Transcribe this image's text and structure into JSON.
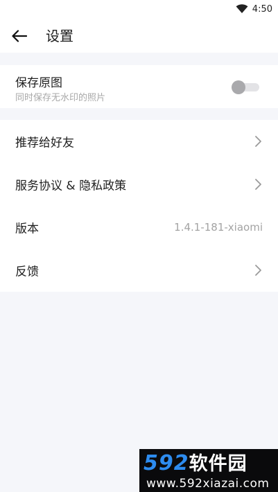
{
  "status_bar": {
    "time": "4:50",
    "wifi_icon": "wifi-icon"
  },
  "app_bar": {
    "back_icon": "arrow-left-icon",
    "title": "设置"
  },
  "save_original": {
    "title": "保存原图",
    "subtitle": "同时保存无水印的照片",
    "enabled": false
  },
  "menu": {
    "recommend": {
      "label": "推荐给好友",
      "icon": "chevron-right-icon"
    },
    "agreement": {
      "label": "服务协议 & 隐私政策",
      "icon": "chevron-right-icon"
    },
    "version": {
      "label": "版本",
      "value": "1.4.1-181-xiaomi"
    },
    "feedback": {
      "label": "反馈",
      "icon": "chevron-right-icon"
    }
  },
  "watermark": {
    "number": "592",
    "brand": "软件园",
    "url": "www.592xiazai.com",
    "number_color": "#2d8cf0"
  },
  "colors": {
    "page_bg": "#f5f6fa",
    "card_bg": "#ffffff",
    "text_primary": "#1f1f1f",
    "text_secondary": "#a8a8a8"
  }
}
